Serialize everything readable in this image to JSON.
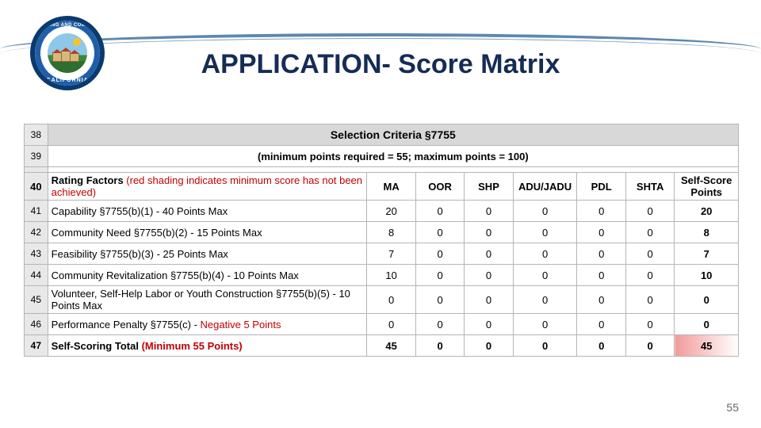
{
  "header": {
    "title": "APPLICATION- Score Matrix",
    "logo_top": "HOUSING AND COMMUNITY DEVELOPMENT",
    "logo_bottom": "· CALIFORNIA ·"
  },
  "table": {
    "banner": "Selection Criteria §7755",
    "subbanner": "(minimum points required = 55; maximum points = 100)",
    "header": {
      "rating_label": "Rating Factors ",
      "rating_note": "(red shading indicates minimum score has not been achieved)",
      "cols": [
        "MA",
        "OOR",
        "SHP",
        "ADU/JADU",
        "PDL",
        "SHTA"
      ],
      "self": "Self-Score Points"
    },
    "rows": [
      {
        "n": "38"
      },
      {
        "n": "39"
      },
      {
        "n": "40"
      },
      {
        "n": "41",
        "label": "Capability §7755(b)(1) - 40 Points Max",
        "v": [
          "20",
          "0",
          "0",
          "0",
          "0",
          "0"
        ],
        "ss": "20"
      },
      {
        "n": "42",
        "label": "Community Need §7755(b)(2) - 15 Points Max",
        "v": [
          "8",
          "0",
          "0",
          "0",
          "0",
          "0"
        ],
        "ss": "8"
      },
      {
        "n": "43",
        "label": "Feasibility §7755(b)(3) - 25 Points Max",
        "v": [
          "7",
          "0",
          "0",
          "0",
          "0",
          "0"
        ],
        "ss": "7"
      },
      {
        "n": "44",
        "label": "Community Revitalization §7755(b)(4) - 10 Points Max",
        "v": [
          "10",
          "0",
          "0",
          "0",
          "0",
          "0"
        ],
        "ss": "10"
      },
      {
        "n": "45",
        "label": "Volunteer, Self-Help Labor or Youth Construction §7755(b)(5) - 10 Points  Max",
        "v": [
          "0",
          "0",
          "0",
          "0",
          "0",
          "0"
        ],
        "ss": "0"
      },
      {
        "n": "46",
        "label_a": "Performance Penalty §7755(c) - ",
        "label_b": "Negative 5 Points",
        "v": [
          "0",
          "0",
          "0",
          "0",
          "0",
          "0"
        ],
        "ss": "0"
      },
      {
        "n": "47",
        "label_a": "Self-Scoring Total ",
        "label_b": "(Minimum 55 Points)",
        "v": [
          "45",
          "0",
          "0",
          "0",
          "0",
          "0"
        ],
        "ss": "45"
      }
    ]
  },
  "page_number": "55"
}
